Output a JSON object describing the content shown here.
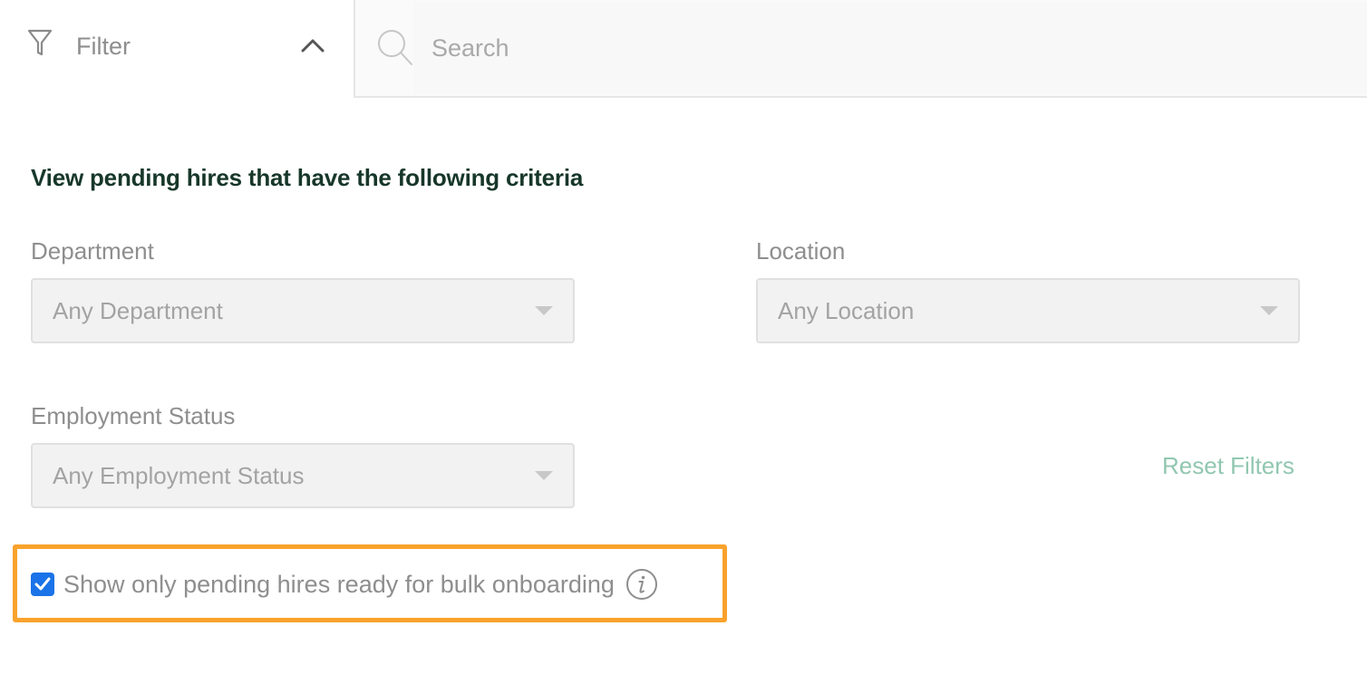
{
  "filter": {
    "label": "Filter",
    "expanded": true,
    "icon": "funnel-icon",
    "toggle_icon": "chevron-up-icon"
  },
  "search": {
    "placeholder": "Search",
    "value": "",
    "icon": "search-icon"
  },
  "criteria": {
    "title": "View pending hires that have the following criteria",
    "fields": [
      {
        "label": "Department",
        "selected": "Any Department"
      },
      {
        "label": "Location",
        "selected": "Any Location"
      },
      {
        "label": "Employment Status",
        "selected": "Any Employment Status"
      }
    ],
    "reset_label": "Reset Filters"
  },
  "bulk_onboarding": {
    "label": "Show only pending hires ready for bulk onboarding",
    "checked": true,
    "info_icon": "info-icon"
  },
  "colors": {
    "title": "#17372a",
    "reset_link": "#91c7b1",
    "highlight": "#f9a22c",
    "checkbox": "#1a73e8"
  }
}
